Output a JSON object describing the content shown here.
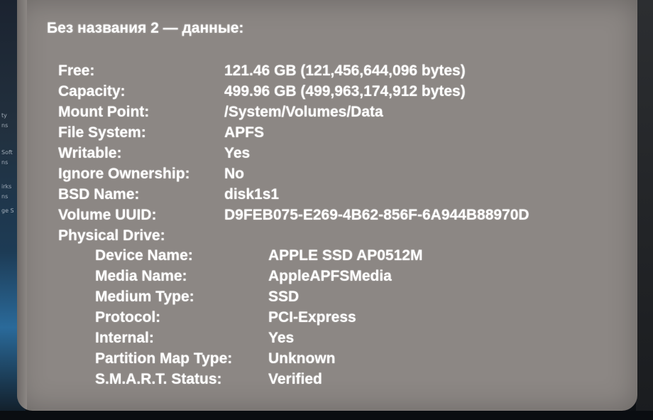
{
  "window": {
    "section_title": "Без названия 2 — данные:"
  },
  "volume": [
    {
      "label": "Free:",
      "value": "121.46 GB (121,456,644,096 bytes)"
    },
    {
      "label": "Capacity:",
      "value": "499.96 GB (499,963,174,912 bytes)"
    },
    {
      "label": "Mount Point:",
      "value": "/System/Volumes/Data"
    },
    {
      "label": "File System:",
      "value": "APFS"
    },
    {
      "label": "Writable:",
      "value": "Yes"
    },
    {
      "label": "Ignore Ownership:",
      "value": "No"
    },
    {
      "label": "BSD Name:",
      "value": "disk1s1"
    },
    {
      "label": "Volume UUID:",
      "value": "D9FEB075-E269-4B62-856F-6A944B88970D"
    },
    {
      "label": "Physical Drive:",
      "value": ""
    }
  ],
  "physical_drive": [
    {
      "label": "Device Name:",
      "value": "APPLE SSD AP0512M"
    },
    {
      "label": "Media Name:",
      "value": "AppleAPFSMedia"
    },
    {
      "label": "Medium Type:",
      "value": "SSD"
    },
    {
      "label": "Protocol:",
      "value": "PCI-Express"
    },
    {
      "label": "Internal:",
      "value": "Yes"
    },
    {
      "label": "Partition Map Type:",
      "value": "Unknown"
    },
    {
      "label": "S.M.A.R.T. Status:",
      "value": "Verified"
    }
  ],
  "background_sidebar": [
    "ty",
    "ns",
    "Soft",
    "ns",
    "irks",
    "ns",
    "ge S"
  ]
}
